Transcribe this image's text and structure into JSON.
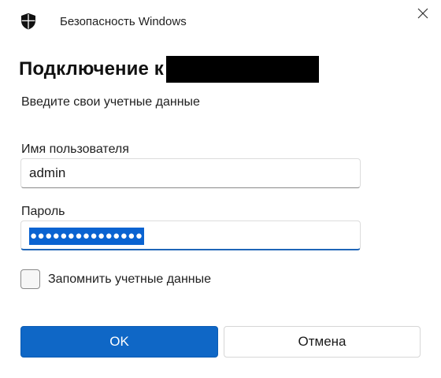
{
  "window": {
    "app_title": "Безопасность Windows",
    "icons": {
      "app": "shield-icon",
      "close": "close-icon"
    }
  },
  "dialog": {
    "heading": "Подключение к",
    "subtitle": "Введите свои учетные данные"
  },
  "form": {
    "username_label": "Имя пользователя",
    "username_value": "admin",
    "password_label": "Пароль",
    "password_value": "●●●●●●●●●●●●●●●",
    "remember_label": "Запомнить учетные данные",
    "remember_checked": false
  },
  "buttons": {
    "ok_label": "OK",
    "cancel_label": "Отмена"
  },
  "colors": {
    "accent": "#0f67c6",
    "selection": "#0a63d1"
  }
}
